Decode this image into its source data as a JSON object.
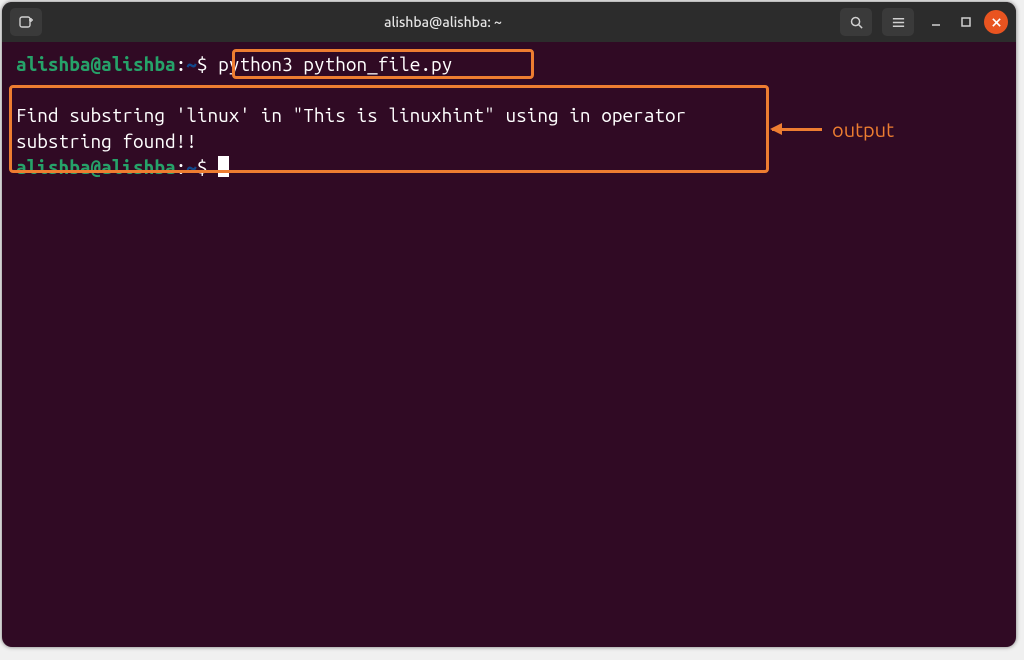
{
  "titlebar": {
    "title": "alishba@alishba: ~"
  },
  "prompt": {
    "user_host": "alishba@alishba",
    "sep": ":",
    "path": "~",
    "symbol": "$"
  },
  "terminal": {
    "command": "python3 python_file.py",
    "output_line1": "Find substring 'linux' in \"This is linuxhint\" using in operator",
    "output_blank": "",
    "output_line2": "substring found!!"
  },
  "annotation": {
    "output_label": "output"
  }
}
